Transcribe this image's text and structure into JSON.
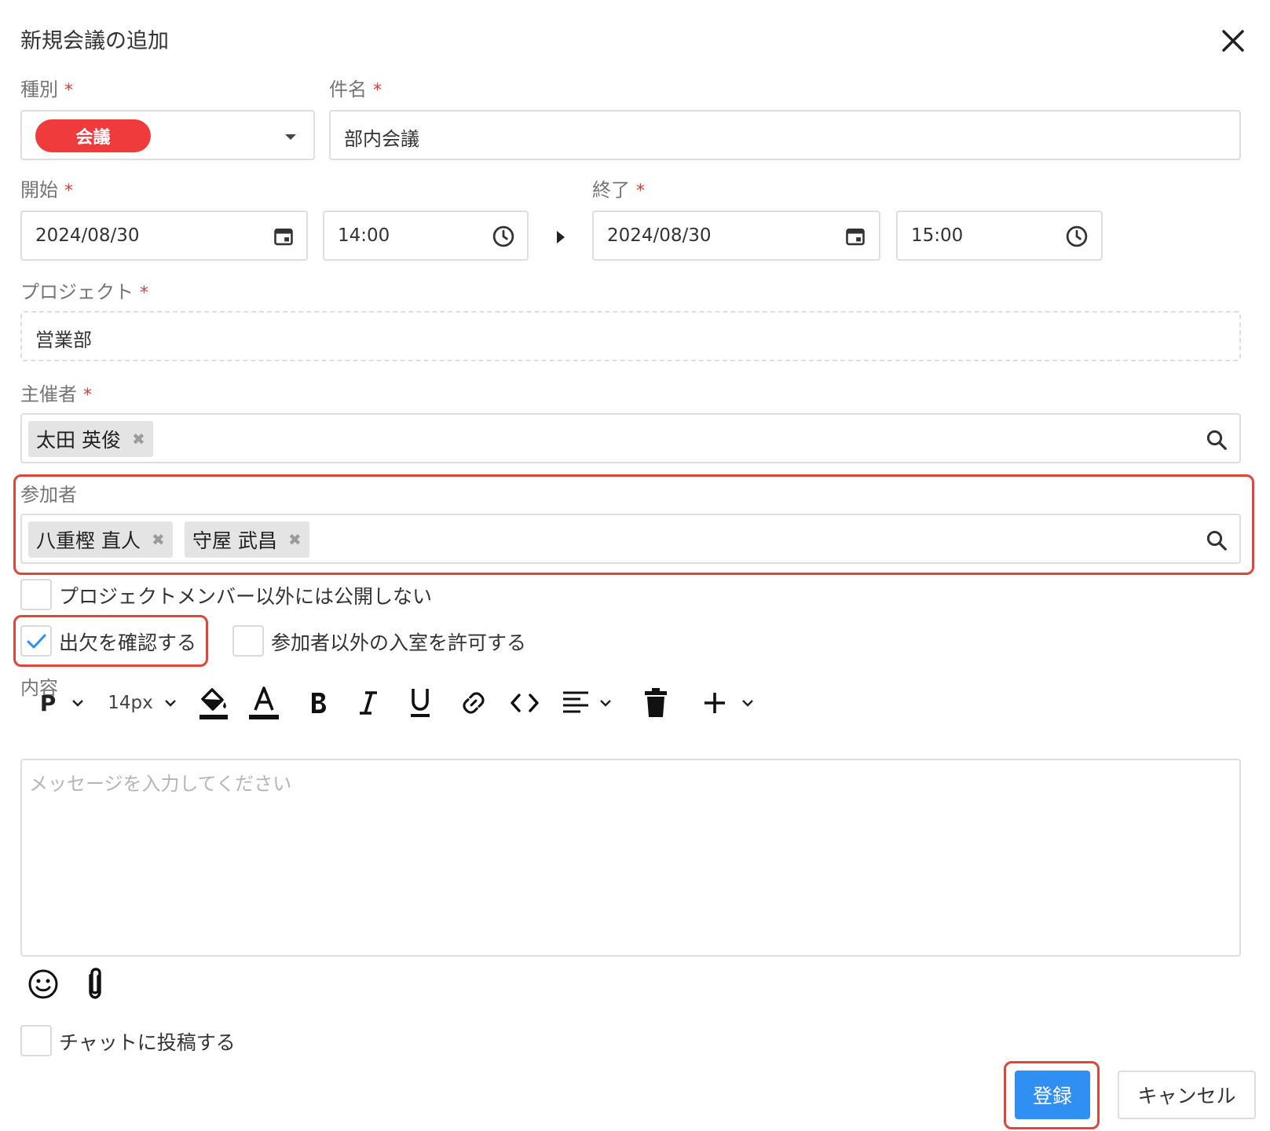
{
  "dialog": {
    "title": "新規会議の追加"
  },
  "fields": {
    "type": {
      "label": "種別",
      "required_mark": "*",
      "value": "会議",
      "color": "#ef3b3b"
    },
    "subject": {
      "label": "件名",
      "required_mark": "*",
      "value": "部内会議"
    },
    "start": {
      "label": "開始",
      "required_mark": "*",
      "date": "2024/08/30",
      "time": "14:00"
    },
    "end": {
      "label": "終了",
      "required_mark": "*",
      "date": "2024/08/30",
      "time": "15:00"
    },
    "project": {
      "label": "プロジェクト",
      "required_mark": "*",
      "value": "営業部"
    },
    "organizer": {
      "label": "主催者",
      "required_mark": "*",
      "chips": [
        "太田 英俊"
      ]
    },
    "participants": {
      "label": "参加者",
      "chips": [
        "八重樫 直人",
        "守屋 武昌"
      ]
    }
  },
  "options": {
    "private": {
      "label": "プロジェクトメンバー以外には公開しない",
      "checked": false
    },
    "attendance": {
      "label": "出欠を確認する",
      "checked": true
    },
    "allow_others": {
      "label": "参加者以外の入室を許可する",
      "checked": false
    },
    "post_chat": {
      "label": "チャットに投稿する",
      "checked": false
    }
  },
  "content": {
    "label": "内容",
    "paragraph": "P",
    "font_size": "14px",
    "placeholder": "メッセージを入力してください"
  },
  "toolbar_icons": [
    "paragraph-style",
    "font-size",
    "fill-color",
    "font-color",
    "bold",
    "italic",
    "underline",
    "link",
    "code",
    "align",
    "delete",
    "insert"
  ],
  "buttons": {
    "submit": "登録",
    "cancel": "キャンセル"
  },
  "colors": {
    "accent": "#2f8ff2",
    "highlight": "#e0453a",
    "required": "#e53935"
  }
}
